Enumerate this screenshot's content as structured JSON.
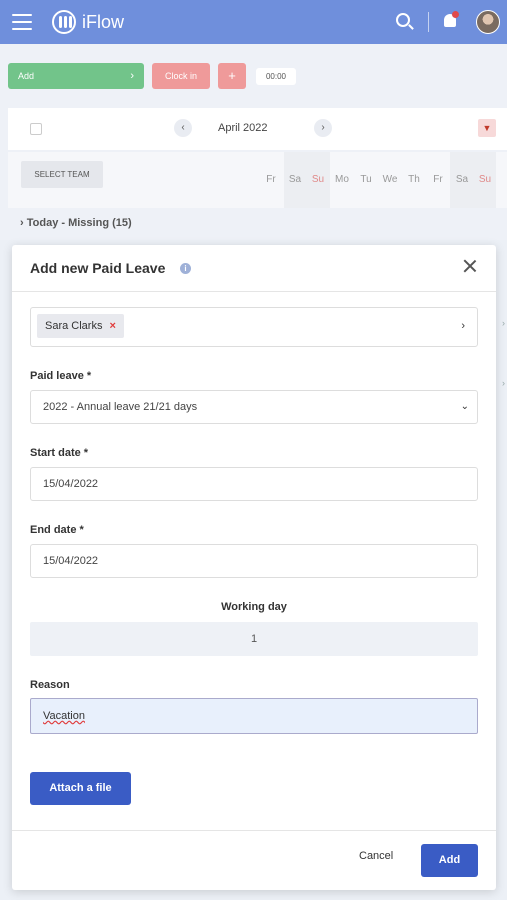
{
  "app": {
    "name": "iFlow"
  },
  "actions": {
    "add_label": "Add",
    "clockin_label": "Clock in",
    "plus_label": "+",
    "timer": "00:00"
  },
  "calendar": {
    "month": "April 2022",
    "select_team_label": "SELECT TEAM",
    "days": [
      "Fr",
      "Sa",
      "Su",
      "Mo",
      "Tu",
      "We",
      "Th",
      "Fr",
      "Sa",
      "Su"
    ],
    "today_label": "Today - Missing (15)"
  },
  "modal": {
    "title": "Add new Paid Leave",
    "employee_chip": "Sara Clarks",
    "paid_leave_label": "Paid leave *",
    "paid_leave_value": "2022 - Annual leave 21/21 days",
    "start_date_label": "Start date *",
    "start_date_value": "15/04/2022",
    "end_date_label": "End date *",
    "end_date_value": "15/04/2022",
    "working_day_label": "Working day",
    "working_day_value": "1",
    "reason_label": "Reason",
    "reason_value": "Vacation",
    "attach_label": "Attach a file",
    "cancel_label": "Cancel",
    "add_label": "Add"
  },
  "colors": {
    "topbar": "#6f8fdc",
    "primary": "#3a5cc5",
    "success": "#72c48a",
    "danger_soft": "#ef9a9a"
  }
}
